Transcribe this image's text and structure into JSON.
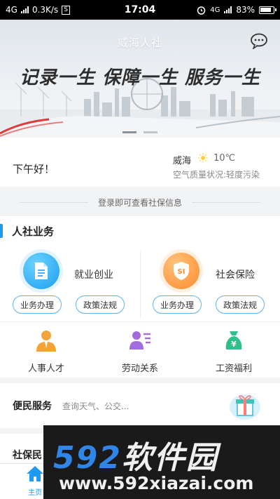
{
  "status_bar": {
    "network": "4G",
    "speed": "0.3K/s",
    "speed_badge": "S",
    "time": "17:04",
    "network_right": "4G",
    "battery": "83%"
  },
  "banner": {
    "title": "威海人社",
    "slogan": "记录一生 保障一生 服务一生",
    "message_icon": "chat-bubble-icon",
    "slides": 2,
    "active_slide": 0
  },
  "greeting": {
    "hello": "下午好！",
    "city": "威海",
    "weather_icon": "sun-icon",
    "temperature": "10℃",
    "air_quality": "空气质量状况:轻度污染"
  },
  "login_hint": "登录即可查看社保信息",
  "business": {
    "title": "人社业务",
    "services": [
      {
        "name": "就业创业",
        "icon": "document-icon",
        "actions": [
          "业务办理",
          "政策法规"
        ]
      },
      {
        "name": "社会保险",
        "icon": "si-shield-icon",
        "icon_text": "SI",
        "actions": [
          "业务办理",
          "政策法规"
        ]
      }
    ],
    "sub_items": [
      {
        "label": "人事人才",
        "icon": "person-icon"
      },
      {
        "label": "劳动关系",
        "icon": "people-list-icon"
      },
      {
        "label": "工资福利",
        "icon": "money-bag-icon"
      }
    ]
  },
  "convenience": {
    "title": "便民服务",
    "subtitle": "查询天气、公交...",
    "icon": "gift-box-icon"
  },
  "social_section": {
    "title": "社保民"
  },
  "tabbar": {
    "home_label": "主页",
    "home_icon": "home-icon"
  },
  "watermark": {
    "number": "592",
    "text": "软件园",
    "url": "www.592xiazai.com"
  },
  "colors": {
    "accent": "#1e9bf0",
    "orange": "#ff8a2e"
  }
}
